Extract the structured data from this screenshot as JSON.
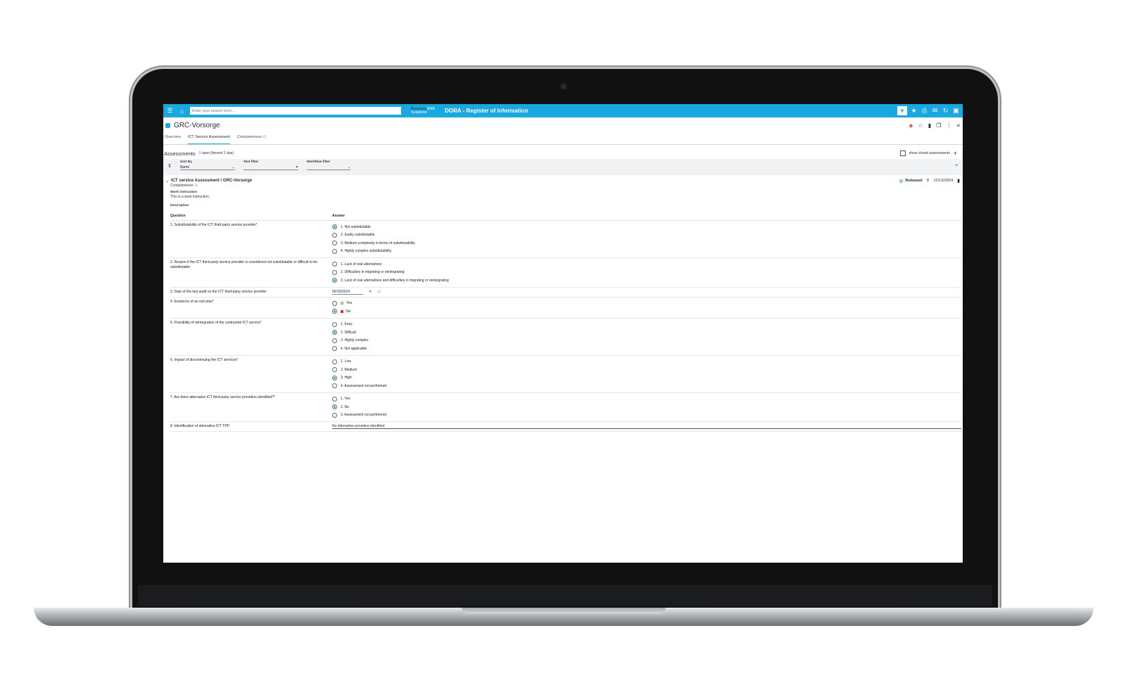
{
  "topbar": {
    "search_placeholder": "Enter your search term...",
    "brand_line1": "Business",
    "brand_line1_accent": "DNA",
    "brand_line2": "Solutions",
    "app_title": "DORA - Register of Information"
  },
  "header": {
    "title": "GRC-Vorsorge"
  },
  "tabs": [
    {
      "label": "Overview"
    },
    {
      "label": "ICT Service Assessment"
    },
    {
      "label": "Completeness"
    }
  ],
  "assessments": {
    "title": "Assessments",
    "count": "1 open (thereof 1 due)",
    "show_closed": "show closed assessments"
  },
  "filters": {
    "sort_label": "Sort By",
    "sort_value": "Name",
    "text_label": "Text filter",
    "workflow_label": "Workflow filter"
  },
  "card": {
    "name": "ICT service Assessment / GRC-Vorsorge",
    "completeness_label": "Completeness:",
    "status": "Released",
    "date": "12/13/2024",
    "work_instruction_label": "Work instruction",
    "work_instruction": "This is a work instruction.",
    "description_label": "Description",
    "question_header": "Question",
    "answer_header": "Answer"
  },
  "questions": [
    {
      "q": "1. Substitutability of the ICT third-party service provider*",
      "options": [
        "1. Not substitutable",
        "2. Easily substitutable",
        "3. Medium complexity in terms of substitutability",
        "4. Highly complex substitutability"
      ],
      "selected": 0
    },
    {
      "q": "2. Reason if the ICT third-party service provider is considered not substitutable or difficult to be substitutable",
      "options": [
        "1. Lack of real alternatives",
        "2. Difficulties in migrating or reintegrating",
        "3. Lack of real alternatives and difficulties in migrating or reintegrating"
      ],
      "selected": 2
    },
    {
      "q": "3. Date of the last audit on the ICT third-party service provider",
      "value": "06/30/2024"
    },
    {
      "q": "4. Existence of an exit plan*",
      "options": [
        "Yes",
        "No"
      ],
      "selected": 1,
      "colors": [
        "#7ed67a",
        "#e03030"
      ]
    },
    {
      "q": "5. Possibility of reintegration of the contracted ICT service*",
      "options": [
        "1. Easy",
        "2. Difficult",
        "3. Highly complex",
        "4. Not applicable"
      ],
      "selected": 1
    },
    {
      "q": "6. Impact of discontinuing the ICT services*",
      "options": [
        "1. Low",
        "2. Medium",
        "3. High",
        "4. Assessment not performed"
      ],
      "selected": 2
    },
    {
      "q": "7. Are there alternative ICT third-party service providers identified?*",
      "options": [
        "1. Yes",
        "2. No",
        "3. Assessment not performed"
      ],
      "selected": 1
    },
    {
      "q": "8. Identification of alternative ICT TPP",
      "value": "No alternative providers identified."
    }
  ]
}
